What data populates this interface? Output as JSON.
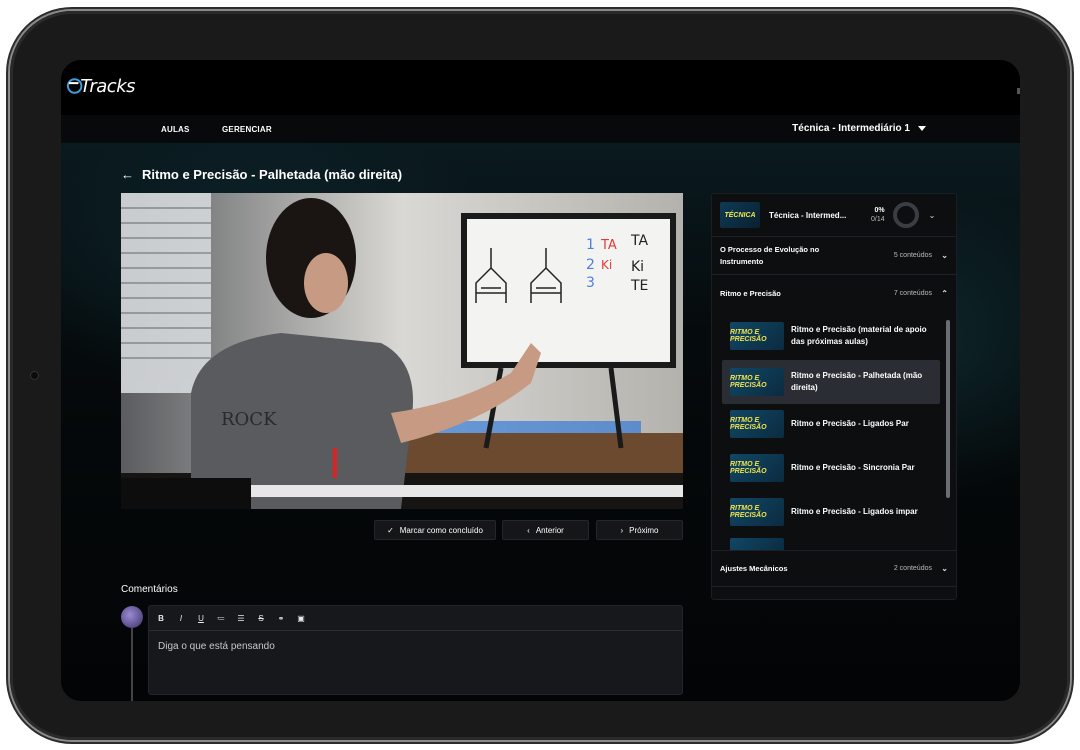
{
  "app": {
    "logo_text": "Tracks"
  },
  "nav": {
    "items": [
      {
        "label": "AULAS"
      },
      {
        "label": "GERENCIAR"
      }
    ],
    "course_selector": "Técnica - Intermediário 1"
  },
  "lesson": {
    "title": "Ritmo e Precisão - Palhetada (mão direita)"
  },
  "video": {
    "board_text": [
      "1",
      "TA",
      "TA",
      "2",
      "Ki",
      "Ki",
      "3",
      "TE"
    ]
  },
  "actions": {
    "mark_complete": "Marcar como concluído",
    "previous": "Anterior",
    "next": "Próximo"
  },
  "comments": {
    "label": "Comentários",
    "toolbar": [
      "B",
      "I",
      "U",
      "≔",
      "☰",
      "S",
      "⚭",
      "▣"
    ],
    "placeholder": "Diga o que está pensando"
  },
  "sidebar": {
    "course": {
      "thumb_text": "TÉCNICA",
      "name": "Técnica - Intermed...",
      "progress_pct": "0%",
      "progress_count": "0/14"
    },
    "sections": [
      {
        "title": "O Processo de Evolução no Instrumento",
        "count": "5 conteúdos"
      },
      {
        "title": "Ritmo e Precisão",
        "count": "7 conteúdos"
      },
      {
        "title": "Ajustes Mecânicos",
        "count": "2 conteúdos"
      }
    ],
    "lessons": [
      {
        "thumb": "RITMO E PRECISÃO",
        "title": "Ritmo e Precisão (material de apoio das próximas aulas)"
      },
      {
        "thumb": "RITMO E PRECISÃO",
        "title": "Ritmo e Precisão - Palhetada (mão direita)"
      },
      {
        "thumb": "RITMO E PRECISÃO",
        "title": "Ritmo e Precisão - Ligados Par"
      },
      {
        "thumb": "RITMO E PRECISÃO",
        "title": "Ritmo e Precisão - Sincronia Par"
      },
      {
        "thumb": "RITMO E PRECISÃO",
        "title": "Ritmo e Precisão - Ligados impar"
      }
    ]
  },
  "colors": {
    "accent": "#f3e24a",
    "active_row": "#2a2d33"
  }
}
